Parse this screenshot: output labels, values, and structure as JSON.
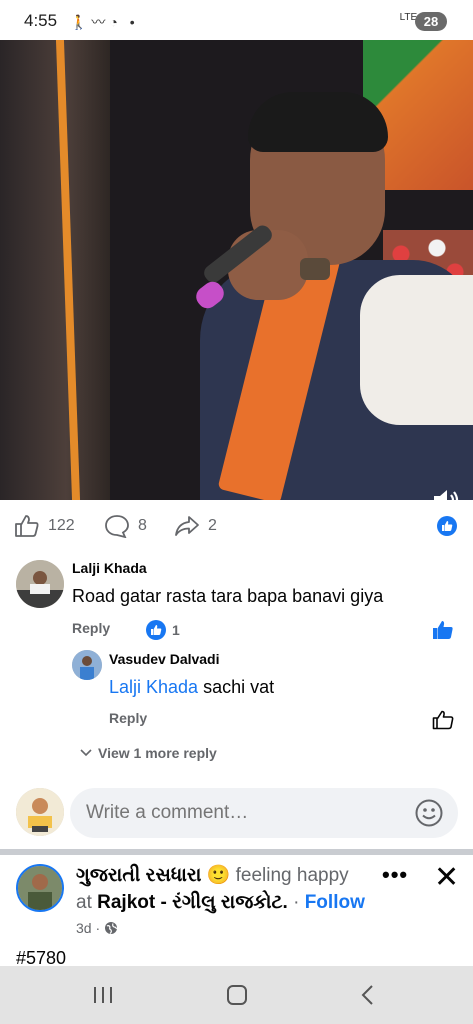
{
  "status_bar": {
    "time": "4:55",
    "network": "LTE+",
    "battery": "28"
  },
  "actions": {
    "likes": "122",
    "comments": "8",
    "shares": "2"
  },
  "comments": [
    {
      "name": "Lalji Khada",
      "text": "Road gatar rasta tara bapa banavi giya",
      "reply_label": "Reply",
      "reaction_count": "1"
    }
  ],
  "reply": {
    "name": "Vasudev Dalvadi",
    "mention": "Lalji Khada",
    "text": " sachi vat",
    "reply_label": "Reply"
  },
  "view_more": "View 1 more reply",
  "composer": {
    "placeholder": "Write a comment…"
  },
  "next_post": {
    "author": "ગુજરાતી રસધારા",
    "feeling": " feeling happy",
    "at": "at ",
    "place": "Rajkot - રંગીલુ રાજકોટ.",
    "follow": "Follow",
    "time": "3d ·",
    "hashtag": "#5780"
  },
  "colors": {
    "accent": "#1877f2",
    "muted": "#65676b"
  }
}
